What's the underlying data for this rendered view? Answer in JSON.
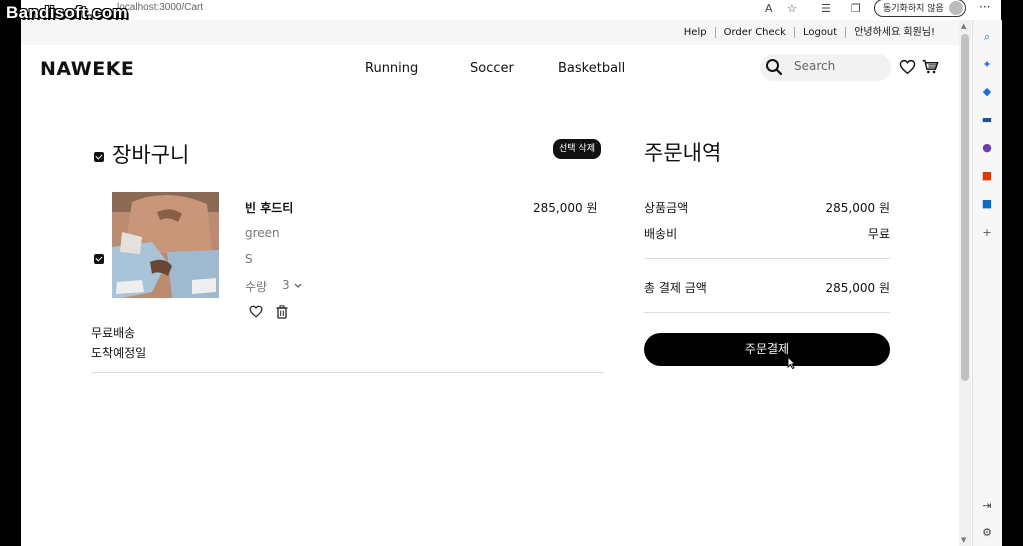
{
  "watermark": "Bandisoft.com",
  "browser": {
    "url": "localhost:3000/Cart",
    "sync_label": "동기화하지 않음",
    "menu_label": "···"
  },
  "site": {
    "top_links": [
      "Help",
      "Order Check",
      "Logout",
      "안녕하세요 회원님!"
    ],
    "logo": "NAWEKE",
    "nav": [
      "Running",
      "Soccer",
      "Basketball"
    ],
    "search_placeholder": "Search"
  },
  "cart": {
    "title": "장바구니",
    "delete_selected": "선택 삭제",
    "item": {
      "name": "빈 후드티",
      "price": "285,000 원",
      "color": "green",
      "size": "S",
      "qty_label": "수량",
      "qty": "3"
    },
    "shipping": "무료배송",
    "arrival": "도착예정일"
  },
  "summary": {
    "title": "주문내역",
    "product_amount_label": "상품금액",
    "product_amount": "285,000 원",
    "delivery_label": "배송비",
    "delivery": "무료",
    "total_label": "총 결제 금액",
    "total": "285,000 원",
    "order_button": "주문결제"
  },
  "colors": {
    "accent": "#111111",
    "topbar_bg": "#f6f6f6",
    "button_bg": "#000000"
  }
}
